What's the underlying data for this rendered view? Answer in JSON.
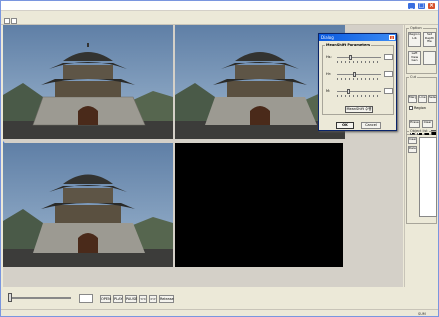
{
  "window": {
    "title": ""
  },
  "menu": [
    "",
    "",
    "",
    "",
    ""
  ],
  "dialog": {
    "title": "Dialog",
    "group_title": "MeanShift Parameters",
    "params": [
      {
        "label": "Hs:",
        "value": 0.3
      },
      {
        "label": "Hr:",
        "value": 0.4
      },
      {
        "label": "M:",
        "value": 0.25
      }
    ],
    "meanshift_button": "MeanShift 수행",
    "ok": "OK",
    "cancel": "Cancel"
  },
  "side_panel": {
    "option_title": "Option",
    "btn_region": "Region Lib",
    "btn_set_depth": "Set Depth file",
    "btn_left_view": "Left View Gen",
    "cut_title": "Cut",
    "btn_merge": "Merge",
    "btn_line": "Line",
    "btn_select": "Select",
    "region_label": "Region",
    "btn_erase": "Erase",
    "btn_clear": "Clear",
    "object_list_title": "Object list",
    "btn_insert": "Insert",
    "btn_delete": "Delete"
  },
  "controls": {
    "open": "OPEN",
    "play": "PLAY",
    "pause": "PAUSE",
    "prev": "<<",
    "next": ">>",
    "release": "Release",
    "seek_position": 0
  },
  "status": {
    "text": "SUM"
  },
  "colors": {
    "title_active": "#0a5adf",
    "close": "#d8502c",
    "canvas_bg": "#d4d0c8",
    "accent": "#3d74d8"
  }
}
